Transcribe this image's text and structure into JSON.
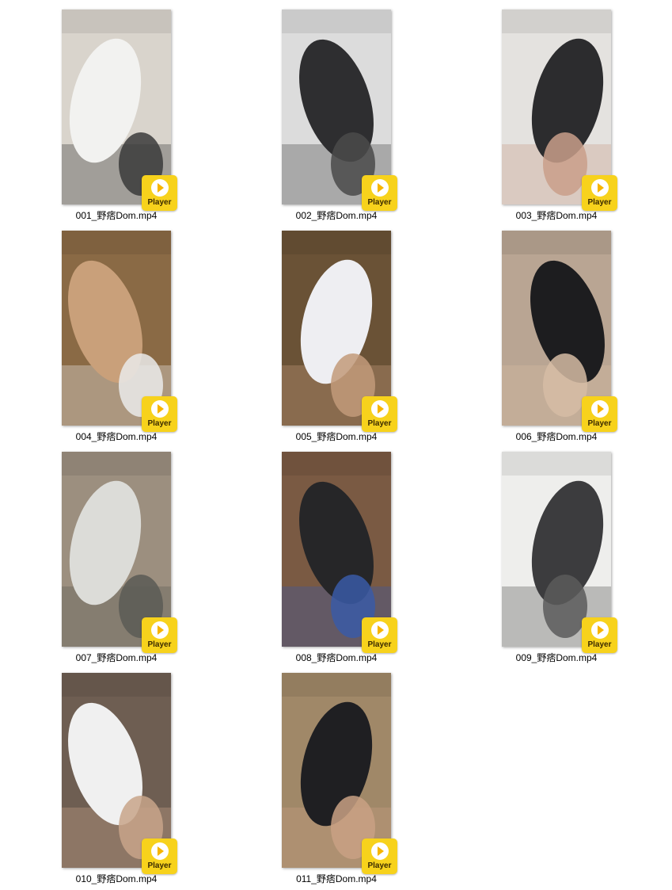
{
  "colors": {
    "badge_bg": "#f7d21c",
    "page_bg": "#ffffff",
    "caption_text": "#000000"
  },
  "badge_label": "Player",
  "files": [
    {
      "name": "001_野痞Dom.mp4",
      "palette": [
        "#d9d4cc",
        "#f2f2f0",
        "#3a3a3a"
      ],
      "icon": "video-thumbnail"
    },
    {
      "name": "002_野痞Dom.mp4",
      "palette": [
        "#dcdcdc",
        "#2e2e30",
        "#4a4a4a"
      ],
      "icon": "video-thumbnail"
    },
    {
      "name": "003_野痞Dom.mp4",
      "palette": [
        "#e4e2df",
        "#2c2c2e",
        "#c99f8a"
      ],
      "icon": "video-thumbnail"
    },
    {
      "name": "004_野痞Dom.mp4",
      "palette": [
        "#8a6a45",
        "#c9a07a",
        "#eaeaea"
      ],
      "icon": "video-thumbnail"
    },
    {
      "name": "005_野痞Dom.mp4",
      "palette": [
        "#6a5236",
        "#eeeef2",
        "#c29a7a"
      ],
      "icon": "video-thumbnail"
    },
    {
      "name": "006_野痞Dom.mp4",
      "palette": [
        "#b9a593",
        "#1d1d1f",
        "#d6bca4"
      ],
      "icon": "video-thumbnail"
    },
    {
      "name": "007_野痞Dom.mp4",
      "palette": [
        "#9c8f7f",
        "#dcdcd8",
        "#5b5b55"
      ],
      "icon": "video-thumbnail"
    },
    {
      "name": "008_野痞Dom.mp4",
      "palette": [
        "#7a5a43",
        "#262628",
        "#3a5aa6"
      ],
      "icon": "video-thumbnail"
    },
    {
      "name": "009_野痞Dom.mp4",
      "palette": [
        "#eeeeec",
        "#3c3c3e",
        "#5a5a5a"
      ],
      "icon": "video-thumbnail"
    },
    {
      "name": "010_野痞Dom.mp4",
      "palette": [
        "#6e5e52",
        "#f0f0f0",
        "#c8a48a"
      ],
      "icon": "video-thumbnail"
    },
    {
      "name": "011_野痞Dom.mp4",
      "palette": [
        "#a08868",
        "#1f1f22",
        "#c9a184"
      ],
      "icon": "video-thumbnail"
    }
  ]
}
